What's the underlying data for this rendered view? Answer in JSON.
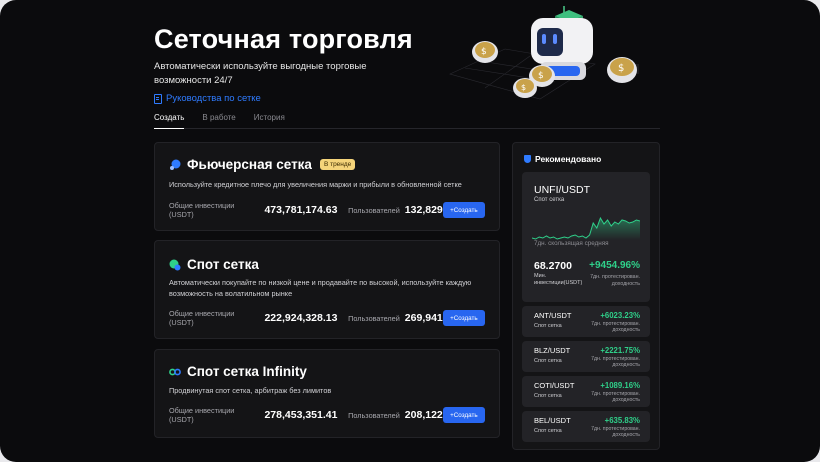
{
  "header": {
    "title": "Сеточная торговля",
    "subtitle": "Автоматически используйте выгодные торговые возможности 24/7",
    "guide_link": "Руководства по сетке"
  },
  "tabs": [
    {
      "label": "Создать",
      "active": true
    },
    {
      "label": "В работе",
      "active": false
    },
    {
      "label": "История",
      "active": false
    }
  ],
  "strategies": [
    {
      "title": "Фьючерсная сетка",
      "badge": "В тренде",
      "icon": "futures-grid-icon",
      "description": "Используйте кредитное плечо для увеличения маржи и прибыли в обновленной сетке",
      "investment_label": "Общие инвестиции (USDT)",
      "investment_value": "473,781,174.63",
      "users_label": "Пользователей",
      "users_value": "132,829",
      "button": "+Создать"
    },
    {
      "title": "Спот сетка",
      "icon": "spot-grid-icon",
      "description": "Автоматически покупайте по низкой цене и продавайте по высокой, используйте каждую возможность на волатильном рынке",
      "investment_label": "Общие инвестиции (USDT)",
      "investment_value": "222,924,328.13",
      "users_label": "Пользователей",
      "users_value": "269,941",
      "button": "+Создать"
    },
    {
      "title": "Спот сетка Infinity",
      "icon": "infinity-grid-icon",
      "description": "Продвинутая спот сетка, арбитраж без лимитов",
      "investment_label": "Общие инвестиции (USDT)",
      "investment_value": "278,453,351.41",
      "users_label": "Пользователей",
      "users_value": "208,122",
      "button": "+Создать"
    }
  ],
  "recommended": {
    "title": "Рекомендовано",
    "featured": {
      "pair": "UNFI/USDT",
      "type": "Спот сетка",
      "avg_label": "7дн. скользящая средняя",
      "price": "68.2700",
      "min_label": "Мин. инвестиции(USDT)",
      "percent": "+9454.96%",
      "note": "7дн. протестирован. доходность",
      "sparkline": [
        30,
        31,
        29,
        30,
        28,
        30,
        29,
        31,
        30,
        29,
        30,
        28,
        27,
        29,
        28,
        30,
        27,
        15,
        20,
        10,
        16,
        12,
        18,
        14,
        16,
        12,
        13,
        15,
        14,
        12,
        13
      ]
    },
    "items": [
      {
        "pair": "ANT/USDT",
        "type": "Спот сетка",
        "percent": "+6023.23%",
        "note": "7дн. протестирован. доходность"
      },
      {
        "pair": "BLZ/USDT",
        "type": "Спот сетка",
        "percent": "+2221.75%",
        "note": "7дн. протестирован. доходность"
      },
      {
        "pair": "COTI/USDT",
        "type": "Спот сетка",
        "percent": "+1089.16%",
        "note": "7дн. протестирован. доходность"
      },
      {
        "pair": "BEL/USDT",
        "type": "Спот сетка",
        "percent": "+635.83%",
        "note": "7дн. протестирован. доходность"
      }
    ]
  },
  "colors": {
    "accent": "#2866f0",
    "positive": "#2fd08a",
    "badge": "#f5d47a",
    "background": "#0b0b0d"
  }
}
